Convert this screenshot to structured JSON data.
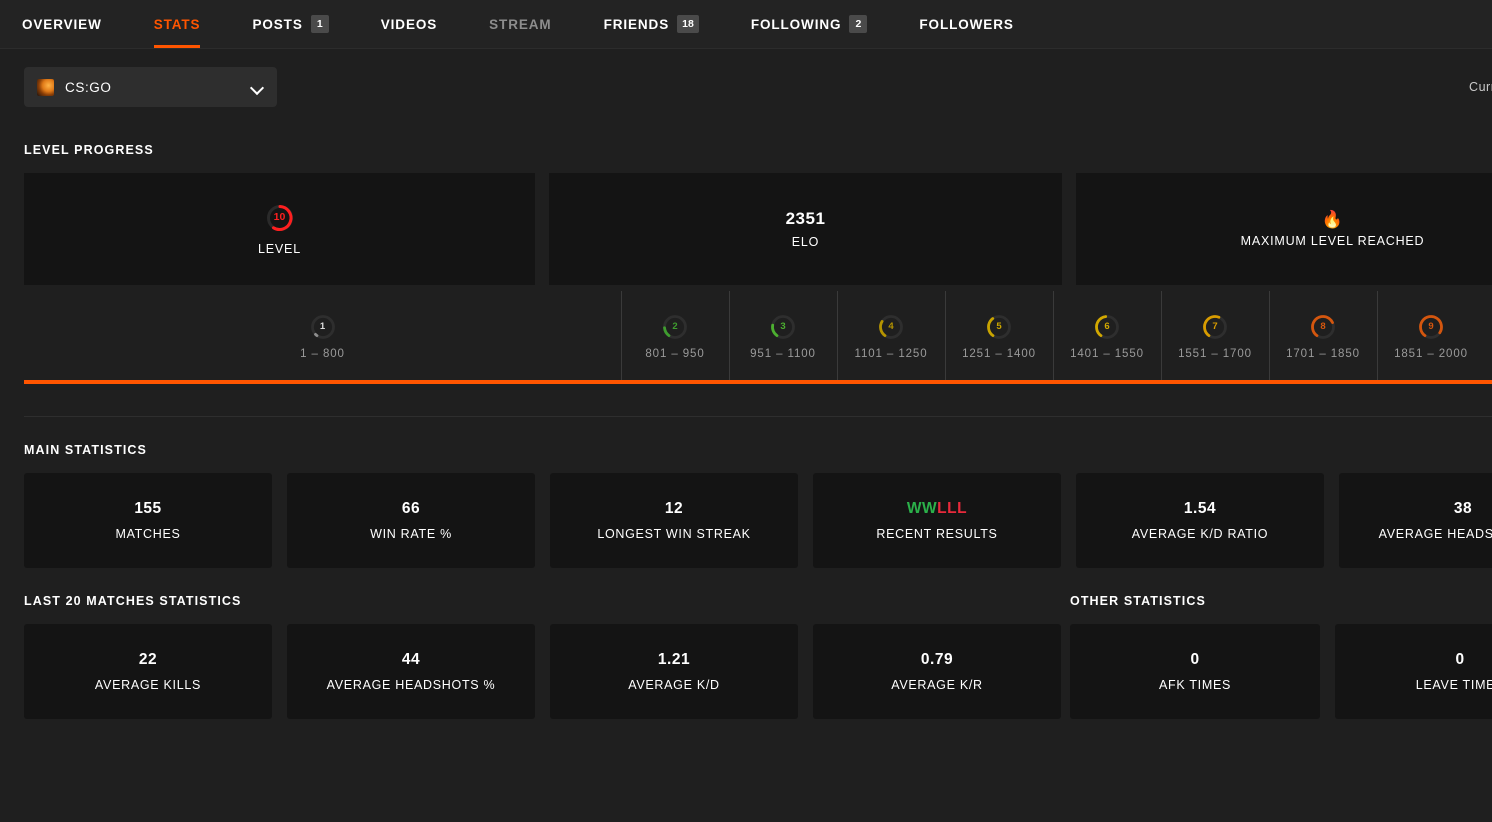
{
  "nav": {
    "tabs": [
      {
        "label": "OVERVIEW",
        "badge": null,
        "state": "normal"
      },
      {
        "label": "STATS",
        "badge": null,
        "state": "active"
      },
      {
        "label": "POSTS",
        "badge": "1",
        "state": "normal"
      },
      {
        "label": "VIDEOS",
        "badge": null,
        "state": "normal"
      },
      {
        "label": "STREAM",
        "badge": null,
        "state": "muted"
      },
      {
        "label": "FRIENDS",
        "badge": "18",
        "state": "normal"
      },
      {
        "label": "FOLLOWING",
        "badge": "2",
        "state": "normal"
      },
      {
        "label": "FOLLOWERS",
        "badge": null,
        "state": "normal"
      }
    ]
  },
  "selector": {
    "game": "CS:GO",
    "current_rank": "Current rank: U"
  },
  "level_progress": {
    "title": "LEVEL PROGRESS",
    "cards": [
      {
        "type": "badge",
        "value": "10",
        "label": "LEVEL",
        "color": "#ff1f1f"
      },
      {
        "type": "value",
        "value": "2351",
        "label": "ELO"
      },
      {
        "type": "flame",
        "value": "🔥",
        "label": "MAXIMUM LEVEL REACHED"
      }
    ],
    "ladder": [
      {
        "level": "1",
        "range": "1 – 800",
        "color": "#8e8e8e",
        "pct": 3
      },
      {
        "level": "2",
        "range": "801 – 950",
        "color": "#3f9d2f",
        "pct": 14
      },
      {
        "level": "3",
        "range": "951 – 1100",
        "color": "#4caf30",
        "pct": 18
      },
      {
        "level": "4",
        "range": "1101 – 1250",
        "color": "#b59400",
        "pct": 24
      },
      {
        "level": "5",
        "range": "1251 – 1400",
        "color": "#c9a400",
        "pct": 30
      },
      {
        "level": "6",
        "range": "1401 – 1550",
        "color": "#d2a800",
        "pct": 38
      },
      {
        "level": "7",
        "range": "1551 – 1700",
        "color": "#d89c00",
        "pct": 46
      },
      {
        "level": "8",
        "range": "1701 – 1850",
        "color": "#d4560e",
        "pct": 58
      },
      {
        "level": "9",
        "range": "1851 – 2000",
        "color": "#d4560e",
        "pct": 74
      }
    ]
  },
  "main_statistics": {
    "title": "MAIN STATISTICS",
    "cards": [
      {
        "value": "155",
        "label": "MATCHES"
      },
      {
        "value": "66",
        "label": "WIN RATE %"
      },
      {
        "value": "12",
        "label": "LONGEST WIN STREAK"
      },
      {
        "value": "WWLLL",
        "label": "RECENT RESULTS",
        "wins": "WW",
        "losses": "LLL"
      },
      {
        "value": "1.54",
        "label": "AVERAGE K/D RATIO"
      },
      {
        "value": "38",
        "label": "AVERAGE HEADSHOTS %"
      }
    ]
  },
  "last20": {
    "title": "LAST 20 MATCHES STATISTICS",
    "cards": [
      {
        "value": "22",
        "label": "AVERAGE KILLS"
      },
      {
        "value": "44",
        "label": "AVERAGE HEADSHOTS %"
      },
      {
        "value": "1.21",
        "label": "AVERAGE K/D"
      },
      {
        "value": "0.79",
        "label": "AVERAGE K/R"
      }
    ]
  },
  "other": {
    "title": "OTHER STATISTICS",
    "cards": [
      {
        "value": "0",
        "label": "AFK TIMES"
      },
      {
        "value": "0",
        "label": "LEAVE TIMES"
      }
    ]
  },
  "colors": {
    "accent": "#ff5500",
    "win": "#2bb14a",
    "loss": "#e8293b",
    "card_bg": "#141414",
    "page_bg": "#1f1f1f"
  }
}
